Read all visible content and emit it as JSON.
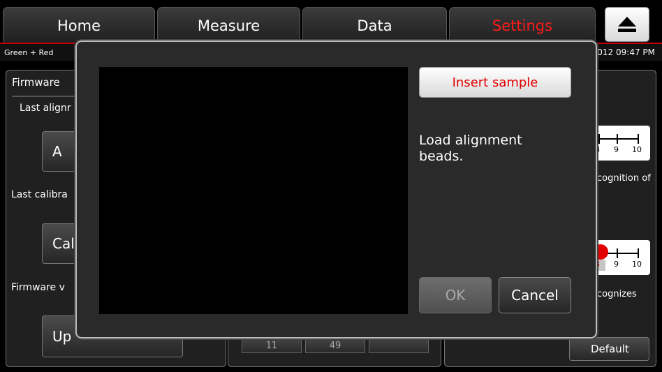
{
  "tabs": [
    {
      "label": "Home"
    },
    {
      "label": "Measure"
    },
    {
      "label": "Data"
    },
    {
      "label": "Settings"
    }
  ],
  "status": {
    "mode": "Green + Red",
    "datetime_fragment": "2012 09:47 PM"
  },
  "settings_panel": {
    "title_fragment": "Firmware",
    "last_alignment_fragment": "Last alignr",
    "align_button_fragment": "A",
    "last_calibration_fragment": "Last calibra",
    "calibrate_button_fragment": "Cali",
    "firmware_version_fragment": "Firmware v",
    "update_button_fragment": "Up"
  },
  "right_panel": {
    "slider1_numbers": [
      "8",
      "9",
      "10"
    ],
    "recognition_fragment": "cognition of",
    "slider2_numbers": [
      "8",
      "9",
      "10"
    ],
    "recognizes_fragment": "cognizes",
    "default_button": "Default"
  },
  "middle_panel": {
    "button_fragments": [
      "11",
      "49",
      ""
    ]
  },
  "dialog": {
    "insert_button": "Insert sample",
    "instruction": "Load alignment beads.",
    "ok_button": "OK",
    "cancel_button": "Cancel"
  },
  "colors": {
    "active_tab": "#ff1a1a",
    "accent_red": "#e00000",
    "panel_bg": "#202020",
    "dialog_bg": "#2a2a2a"
  }
}
